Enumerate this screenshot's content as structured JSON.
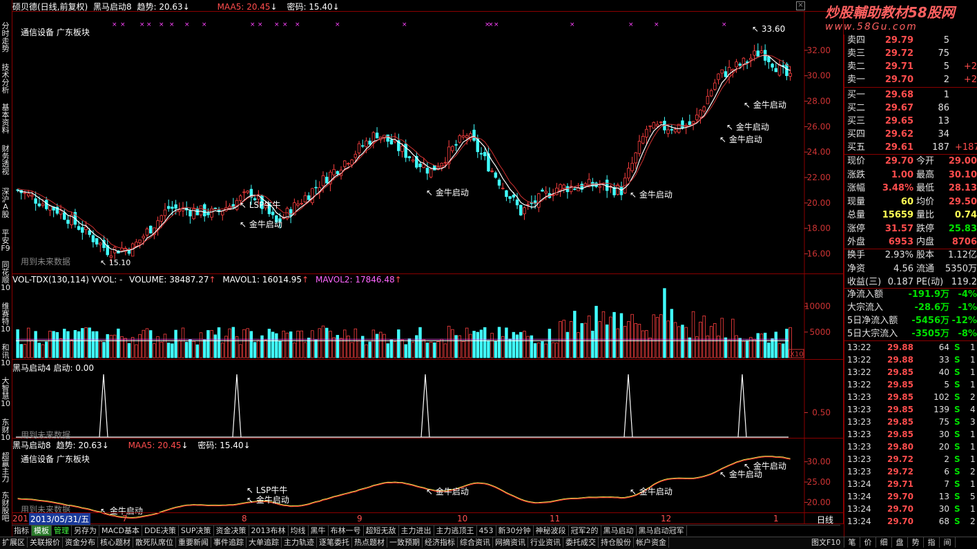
{
  "left_tabs": [
    "分时走势",
    "技术分析",
    "基本资料",
    "财务透视",
    "深沪A股",
    "平安F9",
    "同花顺10",
    "维赛特10",
    "和讯10",
    "大智慧10",
    "东财10",
    "超赢主力",
    "东财股吧"
  ],
  "main_header": {
    "title": "硕贝德(日线,前复权)",
    "ind1": "黑马启动8",
    "ind_trend": "趋势: 20.63",
    "ind_maa": "MAA5: 20.45",
    "ind_pwd": "密码: 15.40"
  },
  "sector_label": "通信设备 广东板块",
  "future_data_label": "用到未来数据",
  "annotations": {
    "lsp": "LSP牛牛",
    "jn": "金牛启动",
    "high_price": "33.60",
    "low_price": "15.10"
  },
  "price_axis": [
    "32.00",
    "30.00",
    "28.00",
    "26.00",
    "24.00",
    "22.00",
    "20.00",
    "18.00",
    "16.00"
  ],
  "vol_header": {
    "name": "VOL-TDX(130,114)",
    "vvol": "VVOL: -",
    "volume": "VOLUME: 38487.27",
    "mavol1": "MAVOL1: 16014.95",
    "mavol2": "MAVOL2: 17846.48"
  },
  "vol_axis": [
    "10000",
    "5000"
  ],
  "vol_unit": "X10",
  "sig_header": "黑马启动4  启动: 0.00",
  "sig_axis": "0.50",
  "bot_header": {
    "ind1": "黑马启动8",
    "trend": "趋势: 20.63",
    "maa": "MAA5: 20.45",
    "pwd": "密码: 15.40"
  },
  "bot_axis": [
    "30.00",
    "25.00",
    "20.00"
  ],
  "date_axis": {
    "cursor": "2013/05/31/五",
    "start": "201",
    "months": [
      "7",
      "8",
      "9",
      "10",
      "11",
      "12",
      "1"
    ],
    "period": "日线"
  },
  "watermark": {
    "line1": "炒股輔助教材58股网",
    "line2": "www.58Gu.com"
  },
  "quote": {
    "asks": [
      {
        "label": "卖四",
        "price": "29.79",
        "vol": "5",
        "chg": ""
      },
      {
        "label": "卖三",
        "price": "29.72",
        "vol": "75",
        "chg": ""
      },
      {
        "label": "卖二",
        "price": "29.71",
        "vol": "5",
        "chg": "+2"
      },
      {
        "label": "卖一",
        "price": "29.70",
        "vol": "2",
        "chg": "+2"
      }
    ],
    "bids": [
      {
        "label": "买一",
        "price": "29.68",
        "vol": "1",
        "chg": ""
      },
      {
        "label": "买二",
        "price": "29.67",
        "vol": "86",
        "chg": ""
      },
      {
        "label": "买三",
        "price": "29.65",
        "vol": "13",
        "chg": ""
      },
      {
        "label": "买四",
        "price": "29.62",
        "vol": "34",
        "chg": ""
      },
      {
        "label": "买五",
        "price": "29.61",
        "vol": "187",
        "chg": "+187"
      }
    ],
    "stats": [
      {
        "l1": "现价",
        "v1": "29.70",
        "l2": "今开",
        "v2": "29.00"
      },
      {
        "l1": "涨跌",
        "v1": "1.00",
        "l2": "最高",
        "v2": "30.10"
      },
      {
        "l1": "涨幅",
        "v1": "3.48%",
        "l2": "最低",
        "v2": "28.13"
      },
      {
        "l1": "现量",
        "v1": "60",
        "l2": "均价",
        "v2": "29.50"
      },
      {
        "l1": "总量",
        "v1": "15659",
        "l2": "量比",
        "v2": "0.74"
      },
      {
        "l1": "涨停",
        "v1": "31.57",
        "l2": "跌停",
        "v2": "25.83"
      },
      {
        "l1": "外盘",
        "v1": "6953",
        "l2": "内盘",
        "v2": "8706"
      }
    ],
    "info": [
      {
        "l1": "换手",
        "v1": "2.93%",
        "l2": "股本",
        "v2": "1.12亿"
      },
      {
        "l1": "净资",
        "v1": "4.56",
        "l2": "流通",
        "v2": "5350万"
      },
      {
        "l1": "收益(三)",
        "v1": "0.187",
        "l2": "PE(动)",
        "v2": "119.2"
      }
    ],
    "flow": [
      {
        "label": "净流入额",
        "value": "-191.9万",
        "pct": "-4%"
      },
      {
        "label": "大宗流入",
        "value": "-28.6万",
        "pct": "-1%"
      },
      {
        "label": "5日净流入额",
        "value": "-5456万",
        "pct": "-12%"
      },
      {
        "label": "5日大宗流入",
        "value": "-3505万",
        "pct": "-8%"
      }
    ]
  },
  "ticks": [
    {
      "t": "13:22",
      "p": "29.88",
      "v": "64",
      "s": "S",
      "n": "1"
    },
    {
      "t": "13:22",
      "p": "29.88",
      "v": "33",
      "s": "S",
      "n": "1"
    },
    {
      "t": "13:22",
      "p": "29.85",
      "v": "40",
      "s": "S",
      "n": "1"
    },
    {
      "t": "13:22",
      "p": "29.85",
      "v": "5",
      "s": "S",
      "n": "1"
    },
    {
      "t": "13:23",
      "p": "29.85",
      "v": "102",
      "s": "S",
      "n": "2"
    },
    {
      "t": "13:23",
      "p": "29.85",
      "v": "139",
      "s": "S",
      "n": "4"
    },
    {
      "t": "13:23",
      "p": "29.85",
      "v": "75",
      "s": "S",
      "n": "3"
    },
    {
      "t": "13:23",
      "p": "29.85",
      "v": "30",
      "s": "S",
      "n": "1"
    },
    {
      "t": "13:23",
      "p": "29.80",
      "v": "20",
      "s": "S",
      "n": "1"
    },
    {
      "t": "13:23",
      "p": "29.72",
      "v": "2",
      "s": "S",
      "n": "1"
    },
    {
      "t": "13:23",
      "p": "29.72",
      "v": "6",
      "s": "S",
      "n": "2"
    },
    {
      "t": "13:24",
      "p": "29.71",
      "v": "7",
      "s": "S",
      "n": "1"
    },
    {
      "t": "13:24",
      "p": "29.70",
      "v": "13",
      "s": "S",
      "n": "5"
    },
    {
      "t": "13:24",
      "p": "29.70",
      "v": "30",
      "s": "S",
      "n": "1"
    },
    {
      "t": "13:24",
      "p": "29.70",
      "v": "68",
      "s": "S",
      "n": "2"
    }
  ],
  "indicator_tabs": [
    "指标",
    "模板",
    "管理",
    "另存为",
    "MACD基本",
    "DDE决策",
    "SUP决策",
    "资金决策",
    "2013布林",
    "均线",
    "黑牛",
    "布林一号",
    "超短无敌",
    "主力进出",
    "主力逃顶王",
    "453",
    "新30分钟",
    "神秘波段",
    "冠军2的",
    "黑马启动",
    "黑马启动冠军"
  ],
  "bottom_tabs": [
    "扩展区",
    "关联报价",
    "资金分布",
    "核心题材",
    "散死队席位",
    "重要新闻",
    "事件追踪",
    "大单追踪",
    "主力轨迹",
    "逐笔委托",
    "热点题材",
    "一致预期",
    "经济指标",
    "综合资讯",
    "网摘资讯",
    "行业资讯",
    "委托成交",
    "持仓股份",
    "帐户资金"
  ],
  "right_bottom": [
    "图文F10",
    "笔",
    "价",
    "细",
    "盘",
    "势",
    "指",
    "间"
  ]
}
